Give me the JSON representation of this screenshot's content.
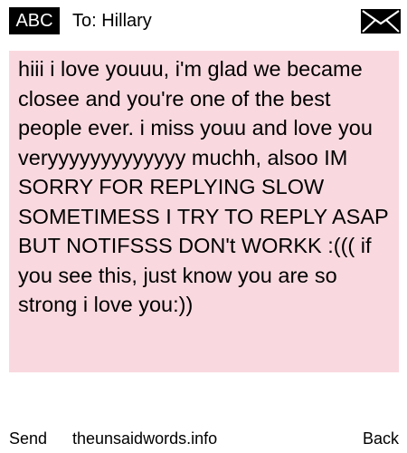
{
  "header": {
    "mode_badge": "ABC",
    "recipient": "To: Hillary",
    "envelope_icon": "envelope-icon"
  },
  "message": {
    "text": "hiii i love youuu, i'm glad we became closee and you're one of the best people ever. i miss youu and love you veryyyyyyyyyyyyy muchh, alsoo IM SORRY FOR REPLYING SLOW SOMETIMESS I TRY TO REPLY ASAP BUT NOTIFSSS DON't WORKK :((( if you see this, just know you are so strong i love you:))"
  },
  "footer": {
    "send_label": "Send",
    "site_label": "theunsaidwords.info",
    "back_label": "Back"
  },
  "colors": {
    "message_background": "#f9d9df",
    "badge_background": "#000000",
    "badge_text": "#ffffff",
    "page_background": "#ffffff"
  }
}
